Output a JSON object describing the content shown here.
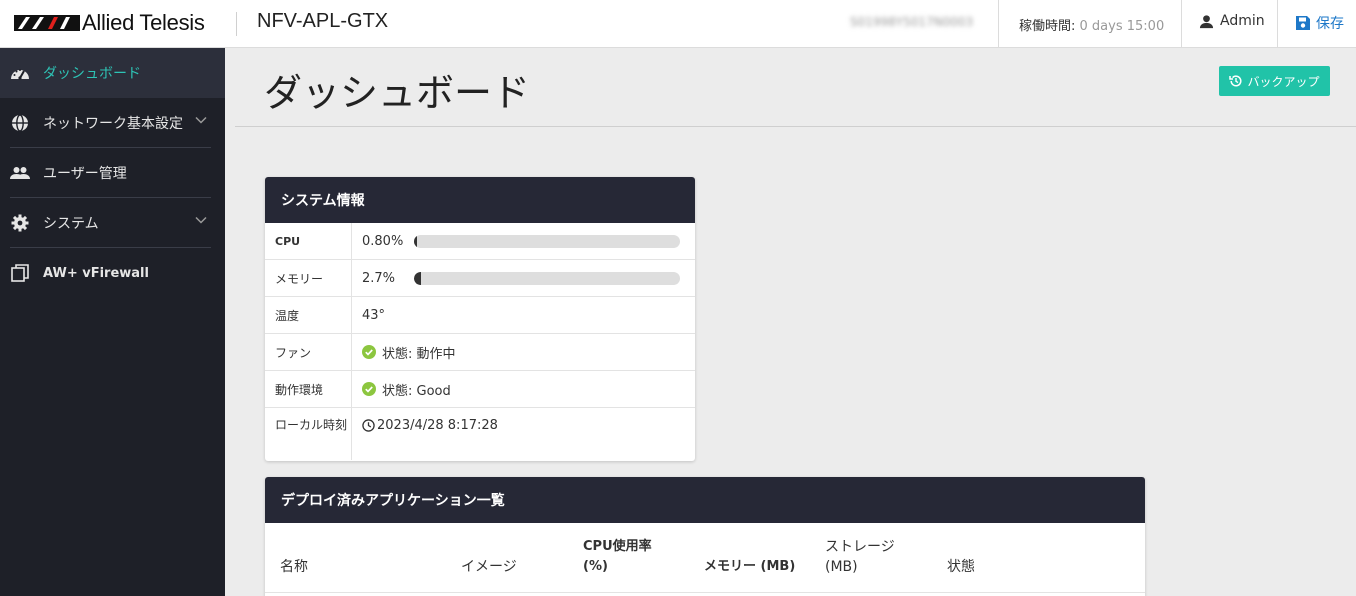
{
  "header": {
    "brand": "Allied Telesis",
    "device_name": "NFV-APL-GTX",
    "serial": "S01998Y5017N0003",
    "uptime_label": "稼働時間:",
    "uptime_value": "0 days 15:00",
    "user": "Admin",
    "save_label": "保存"
  },
  "sidebar": {
    "items": [
      {
        "label": "ダッシュボード",
        "icon": "dashboard-gauge-icon",
        "active": true
      },
      {
        "label": "ネットワーク基本設定",
        "icon": "globe-icon",
        "expandable": true
      },
      {
        "label": "ユーザー管理",
        "icon": "users-icon"
      },
      {
        "label": "システム",
        "icon": "gear-icon",
        "expandable": true
      },
      {
        "label": "AW+ vFirewall",
        "icon": "copy-window-icon"
      }
    ]
  },
  "main": {
    "title": "ダッシュボード",
    "backup_label": "バックアップ"
  },
  "system_info": {
    "title": "システム情報",
    "cpu_label": "CPU",
    "cpu_value": "0.80%",
    "cpu_fraction": 0.008,
    "memory_label": "メモリー",
    "memory_value": "2.7%",
    "memory_fraction": 0.027,
    "temp_label": "温度",
    "temp_value": "43°",
    "fan_label": "ファン",
    "fan_value": "状態: 動作中",
    "env_label": "動作環境",
    "env_value": "状態: Good",
    "time_label": "ローカル時刻",
    "time_value": "2023/4/28 8:17:28"
  },
  "apps": {
    "title": "デプロイ済みアプリケーション一覧",
    "columns": [
      "名称",
      "イメージ",
      "CPU使用率 (%)",
      "メモリー (MB)",
      "ストレージ (MB)",
      "状態"
    ]
  },
  "colors": {
    "accent": "#21c3a8",
    "sidebar_bg": "#1e2028",
    "card_header": "#262836",
    "ok_green": "#8cc63f",
    "save_blue": "#1e78c8"
  }
}
